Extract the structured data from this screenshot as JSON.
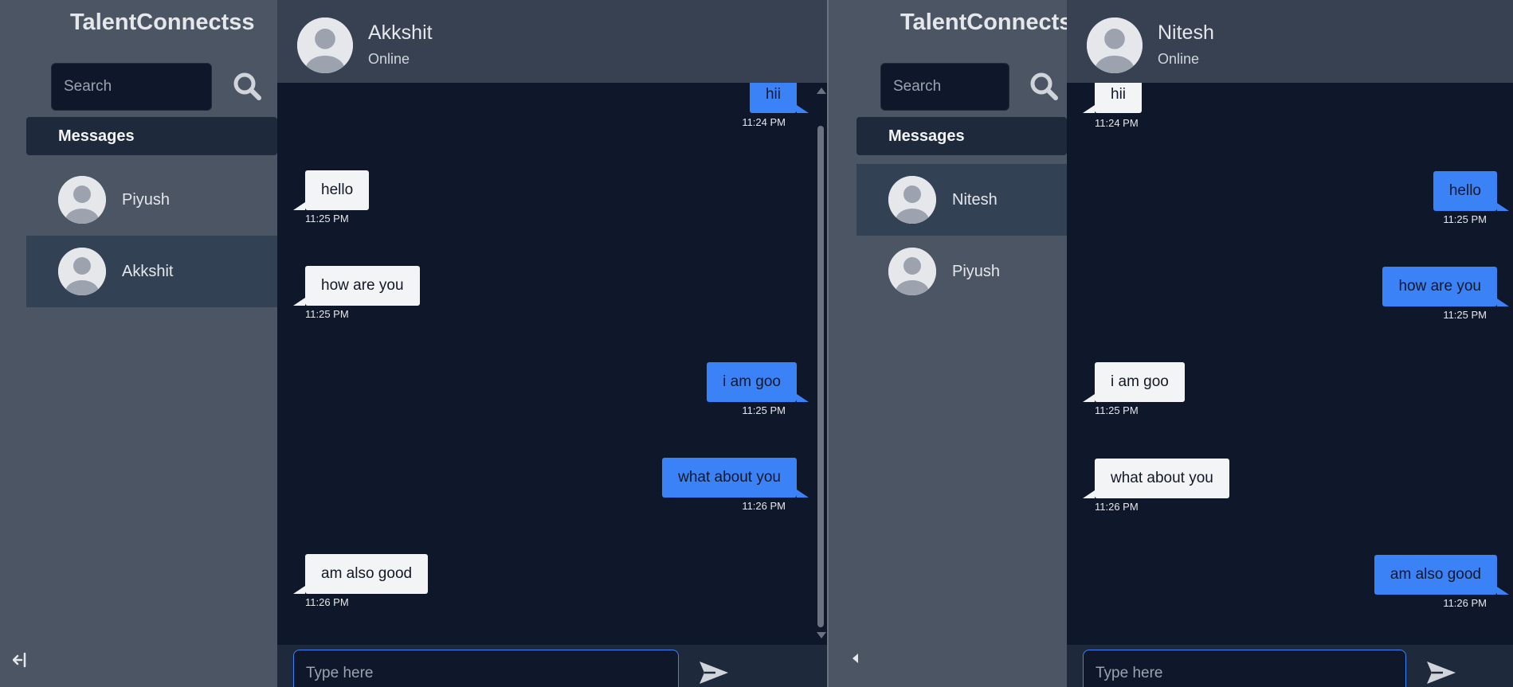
{
  "colors": {
    "sidebar": "#4b5563",
    "chat_bg": "#0f172a",
    "header_bg": "#374151",
    "sent_bubble": "#3b82f6",
    "recv_bubble": "#f3f4f6",
    "active_contact": "#334155"
  },
  "left": {
    "app_title": "TalentConnectss",
    "search": {
      "placeholder": "Search"
    },
    "messages_label": "Messages",
    "contacts": [
      {
        "name": "Piyush",
        "active": false
      },
      {
        "name": "Akkshit",
        "active": true
      }
    ],
    "chat_header": {
      "name": "Akkshit",
      "status": "Online"
    },
    "messages": [
      {
        "text": "hii",
        "time": "11:24 PM",
        "direction": "sent"
      },
      {
        "text": "hello",
        "time": "11:25 PM",
        "direction": "received"
      },
      {
        "text": "how are you",
        "time": "11:25 PM",
        "direction": "received"
      },
      {
        "text": "i am goo",
        "time": "11:25 PM",
        "direction": "sent"
      },
      {
        "text": "what about you",
        "time": "11:26 PM",
        "direction": "sent"
      },
      {
        "text": "am also good",
        "time": "11:26 PM",
        "direction": "received"
      }
    ],
    "composer": {
      "placeholder": "Type here"
    },
    "icons": {
      "search": "search-icon",
      "send": "send-icon",
      "logout": "logout-icon"
    }
  },
  "right": {
    "app_title": "TalentConnectss",
    "search": {
      "placeholder": "Search"
    },
    "messages_label": "Messages",
    "contacts": [
      {
        "name": "Nitesh",
        "active": true
      },
      {
        "name": "Piyush",
        "active": false
      }
    ],
    "chat_header": {
      "name": "Nitesh",
      "status": "Online"
    },
    "messages": [
      {
        "text": "hii",
        "time": "11:24 PM",
        "direction": "received"
      },
      {
        "text": "hello",
        "time": "11:25 PM",
        "direction": "sent"
      },
      {
        "text": "how are you",
        "time": "11:25 PM",
        "direction": "sent"
      },
      {
        "text": "i am goo",
        "time": "11:25 PM",
        "direction": "received"
      },
      {
        "text": "what about you",
        "time": "11:26 PM",
        "direction": "received"
      },
      {
        "text": "am also good",
        "time": "11:26 PM",
        "direction": "sent"
      }
    ],
    "composer": {
      "placeholder": "Type here"
    },
    "icons": {
      "search": "search-icon",
      "send": "send-icon",
      "collapse": "collapse-arrow-icon"
    }
  }
}
